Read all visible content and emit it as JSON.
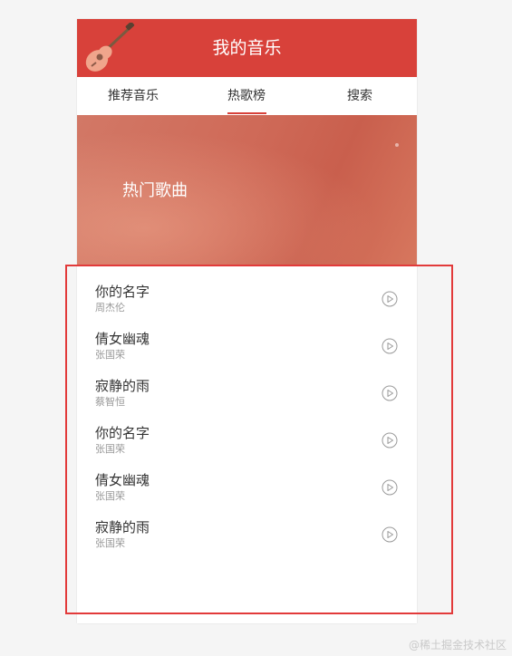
{
  "header": {
    "title": "我的音乐",
    "logo_icon": "guitar-icon",
    "color": "#d8413a"
  },
  "tabs": [
    {
      "label": "推荐音乐",
      "active": false
    },
    {
      "label": "热歌榜",
      "active": true
    },
    {
      "label": "搜索",
      "active": false
    }
  ],
  "banner": {
    "title": "热门歌曲"
  },
  "songs": [
    {
      "name": "你的名字",
      "artist": "周杰伦"
    },
    {
      "name": "倩女幽魂",
      "artist": "张国荣"
    },
    {
      "name": "寂静的雨",
      "artist": "蔡智恒"
    },
    {
      "name": "你的名字",
      "artist": "张国荣"
    },
    {
      "name": "倩女幽魂",
      "artist": "张国荣"
    },
    {
      "name": "寂静的雨",
      "artist": "张国荣"
    }
  ],
  "play_icon": "play-circle-icon",
  "annotation_color": "#e23a3a",
  "watermark": "@稀土掘金技术社区"
}
